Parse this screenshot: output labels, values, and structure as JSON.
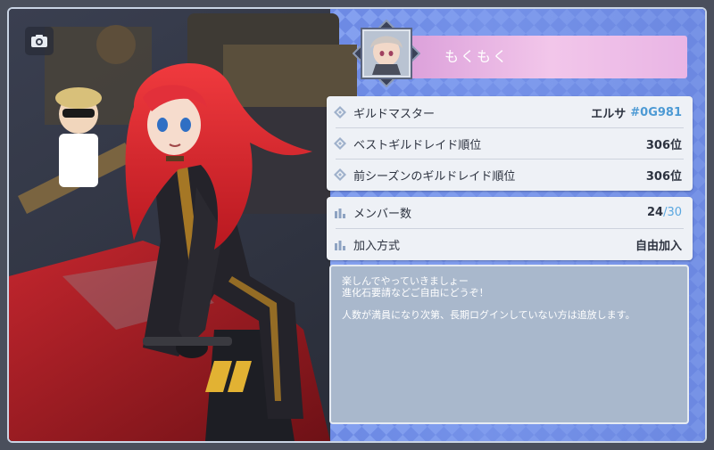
{
  "guild": {
    "name": "もくもく"
  },
  "info_rows": [
    {
      "label": "ギルドマスター",
      "value_name": "エルサ",
      "value_id": "#0G981"
    },
    {
      "label": "ベストギルドレイド順位",
      "value": "306位"
    },
    {
      "label": "前シーズンのギルドレイド順位",
      "value": "306位"
    }
  ],
  "member_rows": {
    "members_label": "メンバー数",
    "members_current": "24",
    "members_separator": "/",
    "members_max": "30",
    "join_label": "加入方式",
    "join_value": "自由加入"
  },
  "description": {
    "line1": "楽しんでやっていきましょー",
    "line2": "進化石要請などご自由にどうぞ！",
    "line3": "人数が満員になり次第、長期ログインしていない方は追放します。"
  },
  "icons": {
    "camera": "camera-icon",
    "diamond": "diamond-bullet-icon",
    "bars": "bar-chart-bullet-icon"
  },
  "colors": {
    "banner": "#e9b5e5",
    "card": "#eef1f6",
    "description_bg": "#a9b8cc",
    "id_accent": "#4d9ad4",
    "hair": "#e0282e"
  }
}
